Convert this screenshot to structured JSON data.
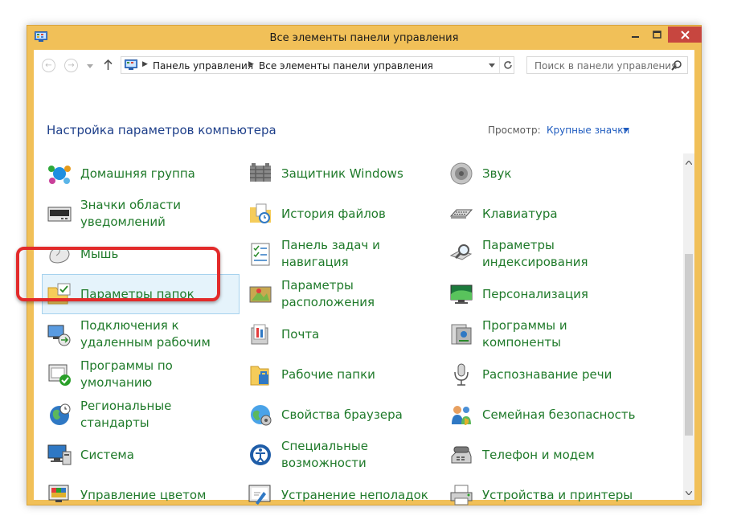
{
  "window": {
    "title": "Все элементы панели управления"
  },
  "nav": {
    "breadcrumb": [
      "Панель управления",
      "Все элементы панели управления"
    ],
    "search_placeholder": "Поиск в панели управления"
  },
  "heading": "Настройка параметров компьютера",
  "view": {
    "label": "Просмотр:",
    "value": "Крупные значки"
  },
  "colors": {
    "title_bar": "#f1c058",
    "link_text": "#1f7a2a",
    "heading": "#1e3f8a",
    "highlight": "#e22a2a",
    "selection": "#e5f3fb"
  },
  "items": [
    {
      "label": "Домашняя группа",
      "icon": "homegroup-icon"
    },
    {
      "label": "Защитник Windows",
      "icon": "windows-defender-icon"
    },
    {
      "label": "Звук",
      "icon": "speaker-icon"
    },
    {
      "label": "Значки области уведомлений",
      "icon": "notification-area-icon"
    },
    {
      "label": "История файлов",
      "icon": "file-history-icon"
    },
    {
      "label": "Клавиатура",
      "icon": "keyboard-icon"
    },
    {
      "label": "Мышь",
      "icon": "mouse-icon"
    },
    {
      "label": "Панель задач и навигация",
      "icon": "taskbar-icon"
    },
    {
      "label": "Параметры индексирования",
      "icon": "indexing-icon"
    },
    {
      "label": "Параметры папок",
      "icon": "folder-options-icon"
    },
    {
      "label": "Параметры расположения",
      "icon": "location-icon"
    },
    {
      "label": "Персонализация",
      "icon": "personalization-icon"
    },
    {
      "label": "Подключения к удаленным рабочим",
      "icon": "remote-desktop-icon"
    },
    {
      "label": "Почта",
      "icon": "mail-icon"
    },
    {
      "label": "Программы и компоненты",
      "icon": "programs-icon"
    },
    {
      "label": "Программы по умолчанию",
      "icon": "default-programs-icon"
    },
    {
      "label": "Рабочие папки",
      "icon": "work-folders-icon"
    },
    {
      "label": "Распознавание речи",
      "icon": "microphone-icon"
    },
    {
      "label": "Региональные стандарты",
      "icon": "region-icon"
    },
    {
      "label": "Свойства браузера",
      "icon": "internet-options-icon"
    },
    {
      "label": "Семейная безопасность",
      "icon": "family-safety-icon"
    },
    {
      "label": "Система",
      "icon": "system-icon"
    },
    {
      "label": "Специальные возможности",
      "icon": "ease-of-access-icon"
    },
    {
      "label": "Телефон и модем",
      "icon": "phone-modem-icon"
    },
    {
      "label": "Управление цветом",
      "icon": "color-management-icon"
    },
    {
      "label": "Устранение неполадок",
      "icon": "troubleshooting-icon"
    },
    {
      "label": "Устройства и принтеры",
      "icon": "printer-icon"
    }
  ]
}
